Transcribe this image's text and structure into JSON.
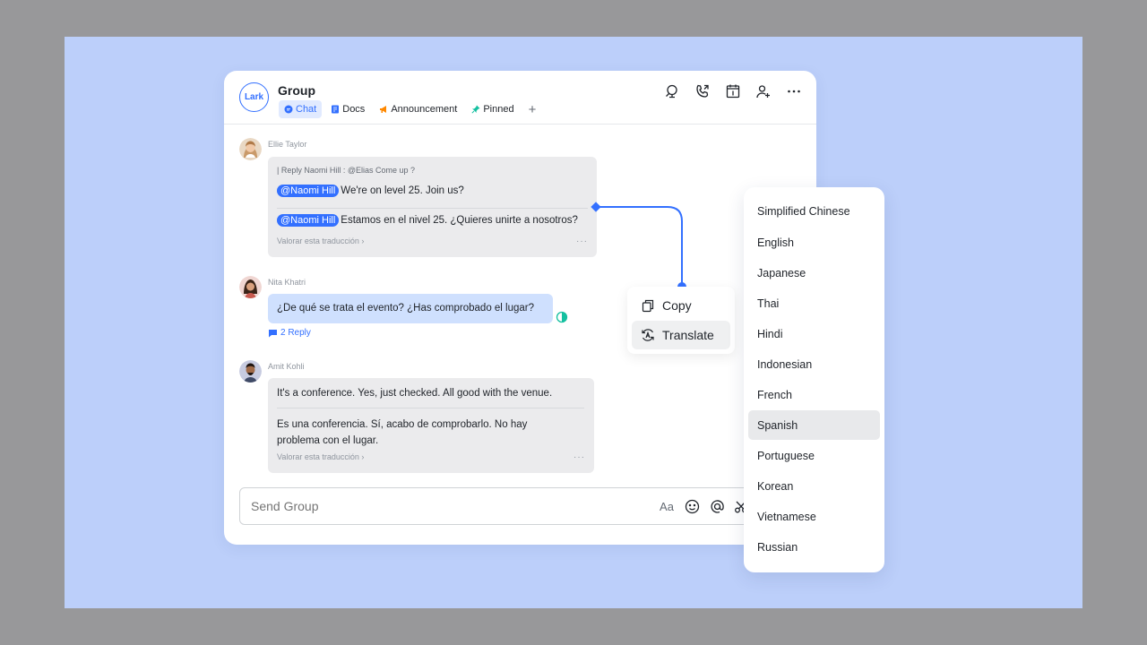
{
  "header": {
    "logo_text": "Lark",
    "title": "Group",
    "tabs": [
      {
        "label": "Chat",
        "icon": "chat-bubble-icon",
        "color": "#3370ff"
      },
      {
        "label": "Docs",
        "icon": "doc-icon",
        "color": "#3370ff"
      },
      {
        "label": "Announcement",
        "icon": "megaphone-icon",
        "color": "#ff8800"
      },
      {
        "label": "Pinned",
        "icon": "pin-icon",
        "color": "#14c0a0"
      }
    ],
    "add_tab_label": "+",
    "actions": [
      "search-icon",
      "call-icon",
      "calendar-icon",
      "add-member-icon",
      "more-icon"
    ]
  },
  "messages": [
    {
      "sender": "Ellie Taylor",
      "reply_to": "| Reply Naomi Hill : @Elias Come up ?",
      "mention": "@Naomi Hill",
      "original": "We're on level 25. Join us?",
      "translated": "Estamos en el nivel 25. ¿Quieres unirte a nosotros?",
      "rate_translation": "Valorar esta traducción",
      "more": "···"
    },
    {
      "sender": "Nita Khatri",
      "text": "¿De qué se trata el evento? ¿Has comprobado el lugar?",
      "reply_count": "2 Reply"
    },
    {
      "sender": "Amit Kohli",
      "original": "It's a conference. Yes, just checked. All good with the venue.",
      "translated_line1": "Es una conferencia. Sí, acabo de comprobarlo. No hay",
      "translated_line2": "problema con el lugar.",
      "rate_translation": "Valorar esta traducción",
      "more": "···"
    }
  ],
  "composer": {
    "placeholder": "Send Group",
    "tools": [
      "text-format-icon",
      "emoji-icon",
      "mention-icon",
      "screenshot-icon",
      "add-icon"
    ],
    "format_label": "Aa"
  },
  "context_menu": {
    "items": [
      {
        "label": "Copy",
        "icon": "copy-icon"
      },
      {
        "label": "Translate",
        "icon": "translate-icon"
      }
    ]
  },
  "languages": {
    "items": [
      "Simplified Chinese",
      "English",
      "Japanese",
      "Thai",
      "Hindi",
      "Indonesian",
      "French",
      "Spanish",
      "Portuguese",
      "Korean",
      "Vietnamese",
      "Russian"
    ],
    "selected": "Spanish"
  },
  "colors": {
    "accent": "#3370ff",
    "background": "#bccffa",
    "outer": "#98989a"
  }
}
